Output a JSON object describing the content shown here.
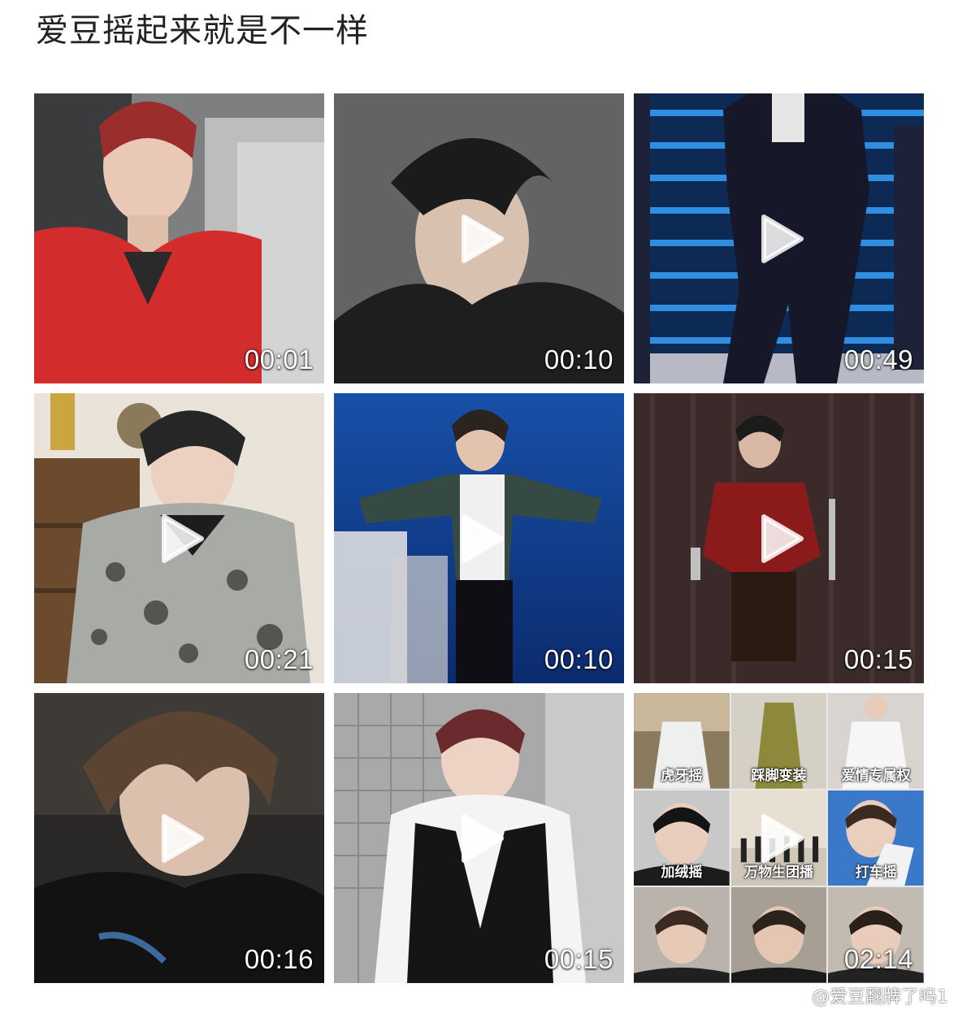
{
  "post": {
    "title": "爱豆摇起来就是不一样"
  },
  "videos": [
    {
      "duration": "00:01"
    },
    {
      "duration": "00:10"
    },
    {
      "duration": "00:49"
    },
    {
      "duration": "00:21"
    },
    {
      "duration": "00:10"
    },
    {
      "duration": "00:15"
    },
    {
      "duration": "00:16"
    },
    {
      "duration": "00:15"
    },
    {
      "duration": "02:14",
      "collage_captions": [
        "虎牙摇",
        "踩脚变装",
        "爱情专属权",
        "加绒摇",
        "万物生团播",
        "打车摇",
        "",
        "",
        ""
      ]
    }
  ],
  "watermark": {
    "text": "@爱豆翻牌了吗1"
  },
  "icons": {
    "play": "play-icon",
    "weibo": "weibo-logo-icon"
  }
}
